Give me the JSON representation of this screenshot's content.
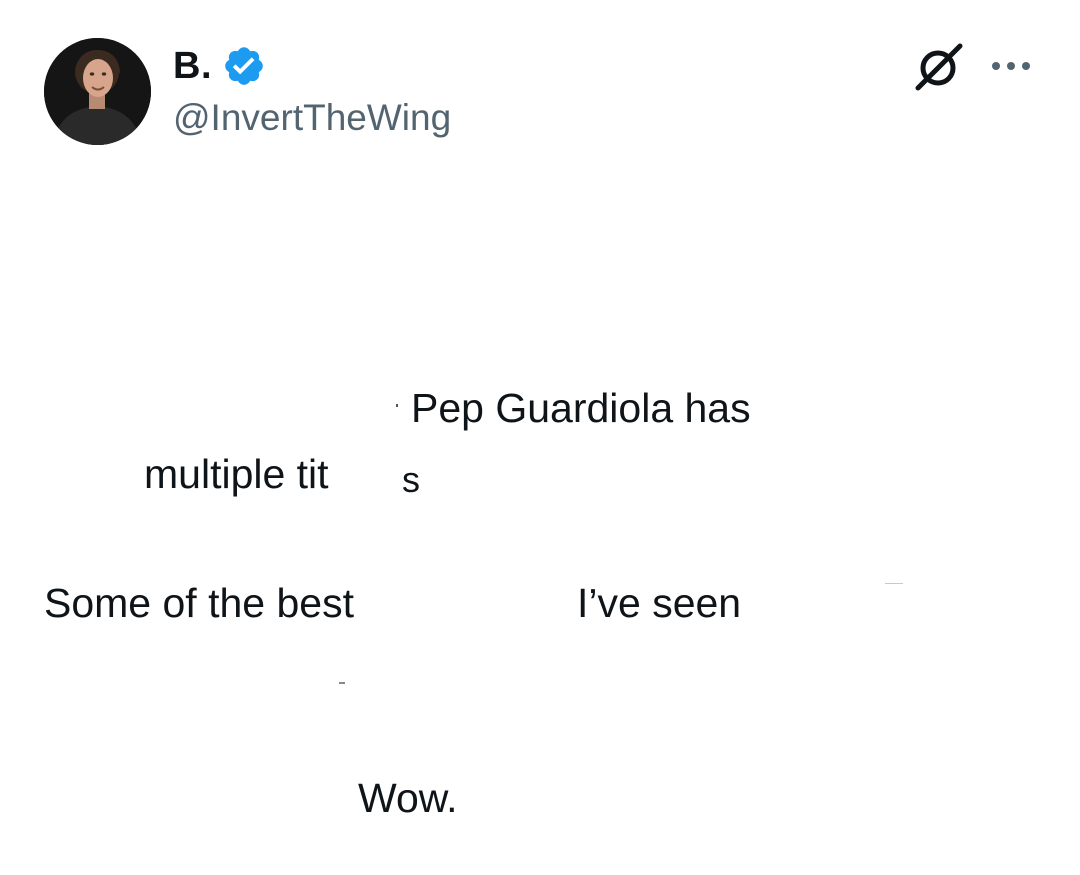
{
  "author": {
    "display_name": "B.",
    "handle": "@InvertTheWing",
    "verified": true,
    "avatar_icon": "profile-photo"
  },
  "header_actions": {
    "grok_icon": "grok-icon",
    "more_icon": "more-icon"
  },
  "tweet": {
    "line1": "Pep Guardiola has",
    "line2a": "multiple tit",
    "line2b": "s",
    "line3a": "Some of the best",
    "line3b": "I’ve seen",
    "line4": "Wow."
  },
  "colors": {
    "text": "#0f1419",
    "secondary_text": "#536471",
    "verified_badge": "#1d9bf0",
    "background": "#ffffff"
  }
}
